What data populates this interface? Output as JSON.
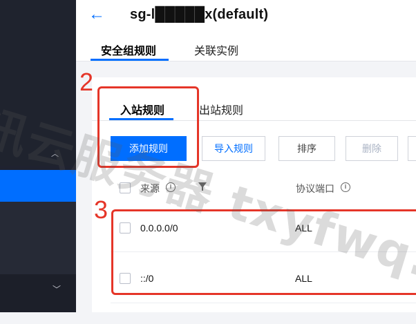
{
  "header": {
    "title": "sg-l█████x(default)",
    "back_icon": "arrow-left-icon"
  },
  "tabs": [
    {
      "label": "安全组规则",
      "active": true
    },
    {
      "label": "关联实例",
      "active": false
    }
  ],
  "subtabs": [
    {
      "label": "入站规则",
      "active": true
    },
    {
      "label": "出站规则",
      "active": false
    }
  ],
  "toolbar": {
    "add_label": "添加规则",
    "import_label": "导入规则",
    "sort_label": "排序",
    "delete_label": "删除"
  },
  "table": {
    "columns": [
      "来源",
      "协议端口"
    ],
    "rows": [
      {
        "source": "0.0.0.0/0",
        "protocol_port": "ALL"
      },
      {
        "source": "::/0",
        "protocol_port": "ALL"
      }
    ]
  },
  "annotations": {
    "step2": "2",
    "step3": "3"
  },
  "watermark": "讯云服务器 txyfwq.com",
  "colors": {
    "accent": "#006eff",
    "annotation": "#e53528",
    "sidebar": "#1f232e"
  }
}
